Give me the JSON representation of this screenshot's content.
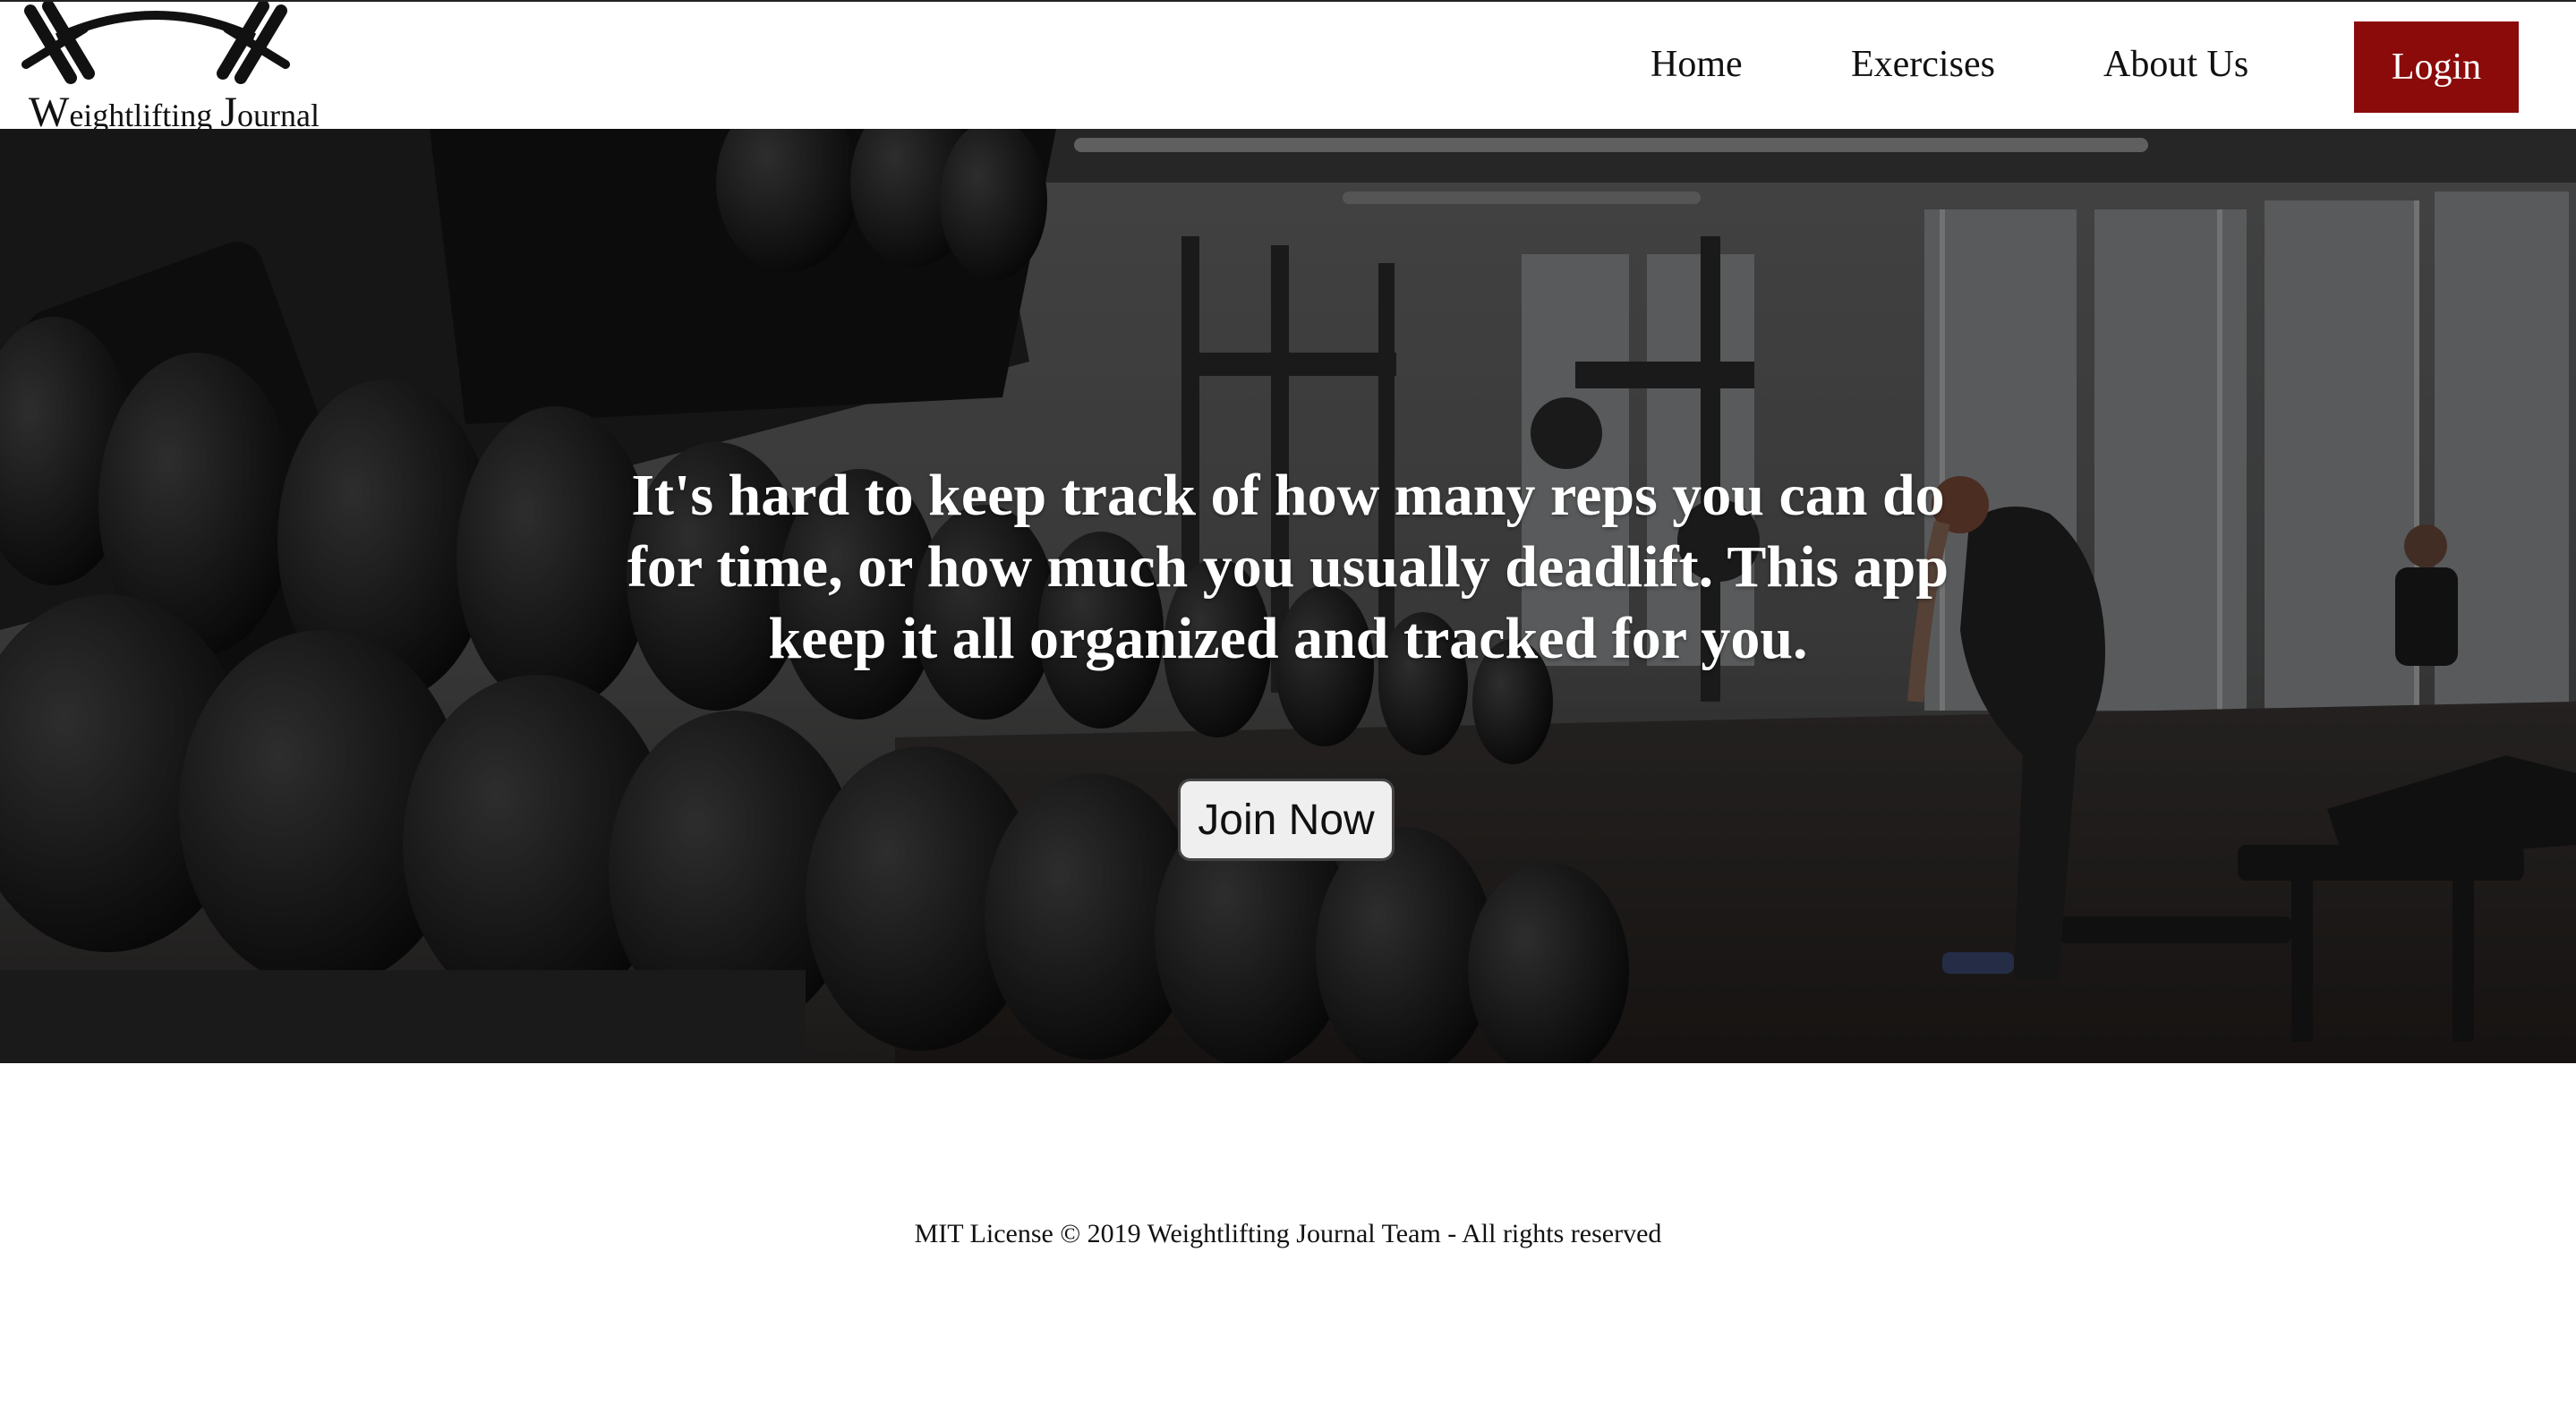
{
  "brand": {
    "logo_text_first_initial": "W",
    "logo_text_first_rest": "eightlifting",
    "logo_text_second_initial": "J",
    "logo_text_second_rest": "ournal",
    "logo_icon": "barbell-icon"
  },
  "nav": {
    "items": [
      {
        "label": "Home"
      },
      {
        "label": "Exercises"
      },
      {
        "label": "About Us"
      }
    ],
    "login_label": "Login"
  },
  "hero": {
    "headline": "It's hard to keep track of how many reps you can do for time, or how much you usually deadlift. This app keep it all organized and tracked for you.",
    "cta_label": "Join Now",
    "background": "gym-dumbbell-rack-photo"
  },
  "footer": {
    "text": "MIT License © 2019 Weightlifting Journal Team - All rights reserved"
  },
  "colors": {
    "accent": "#8b0a0a",
    "header_bg": "#ffffff",
    "text": "#111111"
  }
}
